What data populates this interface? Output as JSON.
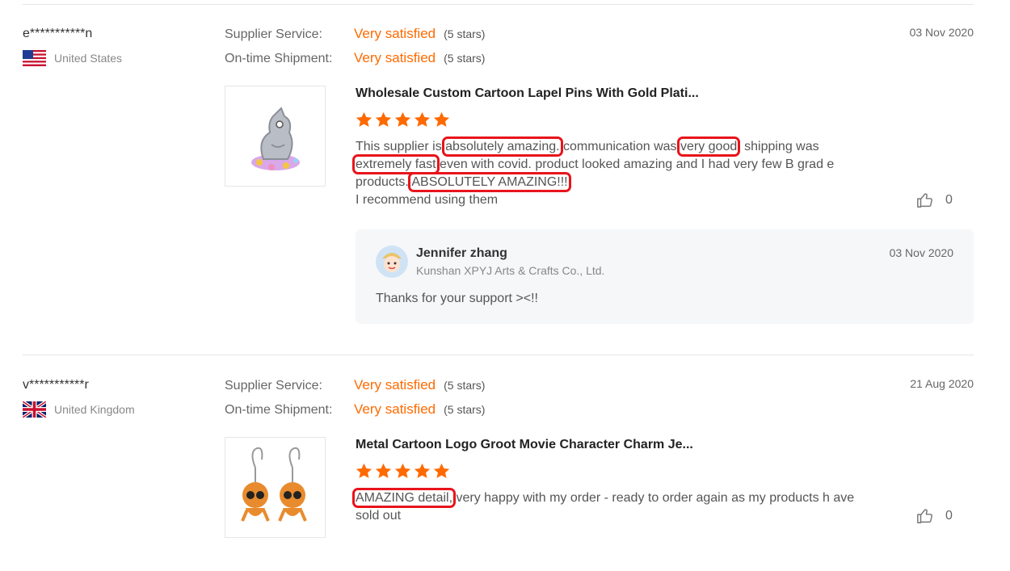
{
  "reviews": [
    {
      "user": "e***********n",
      "country": "United States",
      "supplier_service_label": "Supplier Service:",
      "supplier_service_value": "Very satisfied",
      "supplier_service_stars": "(5 stars)",
      "shipment_label": "On-time Shipment:",
      "shipment_value": "Very satisfied",
      "shipment_stars": "(5 stars)",
      "date": "03 Nov 2020",
      "product_title": "Wholesale Custom Cartoon Lapel Pins With Gold Plati...",
      "rating": 5,
      "text_parts": [
        "This supplier is ",
        "absolutely amazing.",
        " communication was ",
        "very good",
        ". shipping was ",
        "extremely fast",
        " even with covid. product looked amazing and I had very few B grad e products. ",
        "ABSOLUTELY AMAZING!!!",
        "I recommend using them"
      ],
      "likes": "0",
      "reply": {
        "name": "Jennifer zhang",
        "company": "Kunshan XPYJ Arts & Crafts Co., Ltd.",
        "date": "03 Nov 2020",
        "text": "Thanks for your support ><!!"
      }
    },
    {
      "user": "v***********r",
      "country": "United Kingdom",
      "supplier_service_label": "Supplier Service:",
      "supplier_service_value": "Very satisfied",
      "supplier_service_stars": "(5 stars)",
      "shipment_label": "On-time Shipment:",
      "shipment_value": "Very satisfied",
      "shipment_stars": "(5 stars)",
      "date": "21 Aug 2020",
      "product_title": "Metal Cartoon Logo Groot Movie Character Charm Je...",
      "rating": 5,
      "text_parts": [
        "AMAZING detail,",
        " very happy with my order - ready to order again as my products h ave sold out"
      ],
      "likes": "0"
    }
  ],
  "colors": {
    "accent": "#ff6a00",
    "highlight": "#e8141b",
    "reply_bg": "#f6f7f9"
  },
  "icons": {
    "like": "thumbs-up-icon",
    "star": "star-icon"
  }
}
